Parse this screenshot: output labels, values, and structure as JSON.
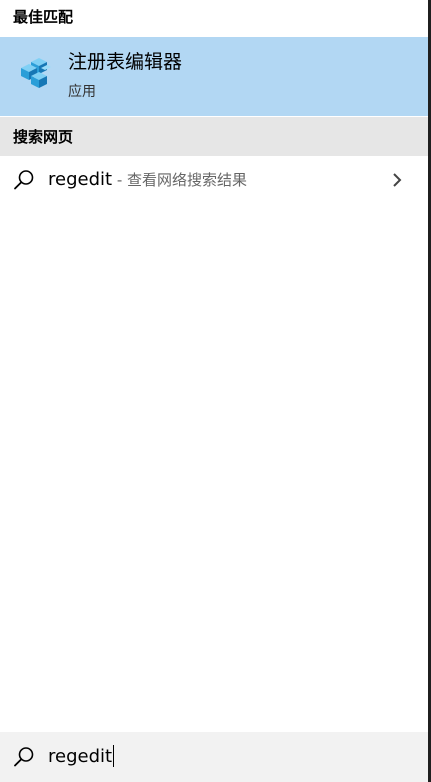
{
  "best_match": {
    "title": "最佳匹配",
    "item": {
      "name": "注册表编辑器",
      "type": "应用",
      "icon": "registry-editor-icon"
    }
  },
  "web_search": {
    "title": "搜索网页",
    "item": {
      "query": "regedit",
      "suffix": " - 查看网络搜索结果",
      "icon": "search-icon",
      "chevron": "chevron-right-icon"
    }
  },
  "search_box": {
    "value": "regedit",
    "icon": "search-icon"
  },
  "colors": {
    "selected_background": "#b2d7f3",
    "section_header_background": "#e6e6e6",
    "search_box_background": "#f2f2f2"
  }
}
